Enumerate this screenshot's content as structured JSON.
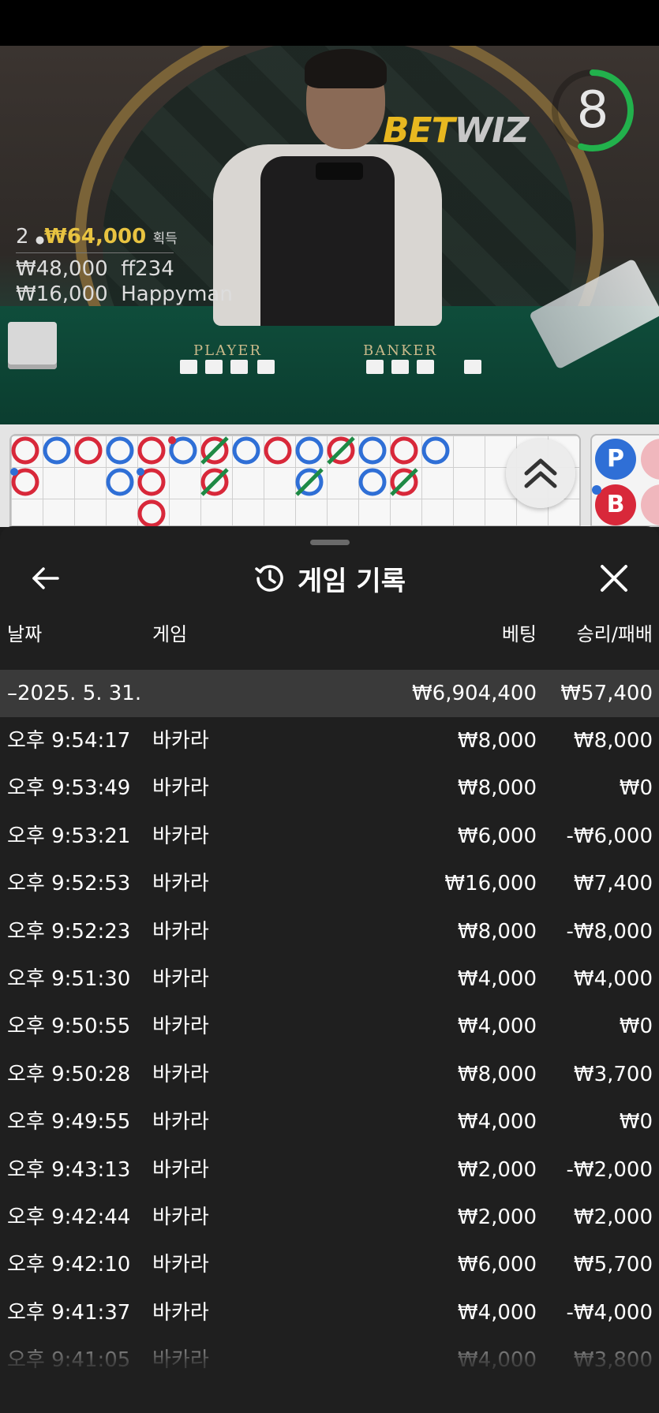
{
  "video": {
    "brand_part1": "BET",
    "brand_part2": "WIZ",
    "countdown": "8",
    "countdown_fraction": 0.55,
    "winners": {
      "count": "2",
      "total": "₩64,000",
      "total_label": "획득",
      "list": [
        {
          "amount": "₩48,000",
          "name": "ff234"
        },
        {
          "amount": "₩16,000",
          "name": "Happyman"
        }
      ]
    },
    "table_labels": {
      "player": "PLAYER",
      "banker": "BANKER"
    }
  },
  "road": {
    "colors": {
      "banker": "#d8283a",
      "player": "#2f6fd6",
      "tie": "#1e8a45"
    },
    "side_labels": {
      "player": "P",
      "banker": "B"
    }
  },
  "history": {
    "title": "게임 기록",
    "icons": {
      "back": "arrow-left-icon",
      "history": "history-icon",
      "close": "close-icon"
    },
    "columns": {
      "date": "날짜",
      "game": "게임",
      "bet": "베팅",
      "result": "승리/패배"
    },
    "date_group": {
      "date": "–2025. 5. 31.",
      "bet": "₩6,904,400",
      "result": "₩57,400"
    },
    "rows": [
      {
        "time": "오후 9:54:17",
        "game": "바카라",
        "bet": "₩8,000",
        "result": "₩8,000"
      },
      {
        "time": "오후 9:53:49",
        "game": "바카라",
        "bet": "₩8,000",
        "result": "₩0"
      },
      {
        "time": "오후 9:53:21",
        "game": "바카라",
        "bet": "₩6,000",
        "result": "-₩6,000"
      },
      {
        "time": "오후 9:52:53",
        "game": "바카라",
        "bet": "₩16,000",
        "result": "₩7,400"
      },
      {
        "time": "오후 9:52:23",
        "game": "바카라",
        "bet": "₩8,000",
        "result": "-₩8,000"
      },
      {
        "time": "오후 9:51:30",
        "game": "바카라",
        "bet": "₩4,000",
        "result": "₩4,000"
      },
      {
        "time": "오후 9:50:55",
        "game": "바카라",
        "bet": "₩4,000",
        "result": "₩0"
      },
      {
        "time": "오후 9:50:28",
        "game": "바카라",
        "bet": "₩8,000",
        "result": "₩3,700"
      },
      {
        "time": "오후 9:49:55",
        "game": "바카라",
        "bet": "₩4,000",
        "result": "₩0"
      },
      {
        "time": "오후 9:43:13",
        "game": "바카라",
        "bet": "₩2,000",
        "result": "-₩2,000"
      },
      {
        "time": "오후 9:42:44",
        "game": "바카라",
        "bet": "₩2,000",
        "result": "₩2,000"
      },
      {
        "time": "오후 9:42:10",
        "game": "바카라",
        "bet": "₩6,000",
        "result": "₩5,700"
      },
      {
        "time": "오후 9:41:37",
        "game": "바카라",
        "bet": "₩4,000",
        "result": "-₩4,000"
      },
      {
        "time": "오후 9:41:05",
        "game": "바카라",
        "bet": "₩4,000",
        "result": "₩3,800"
      }
    ]
  }
}
